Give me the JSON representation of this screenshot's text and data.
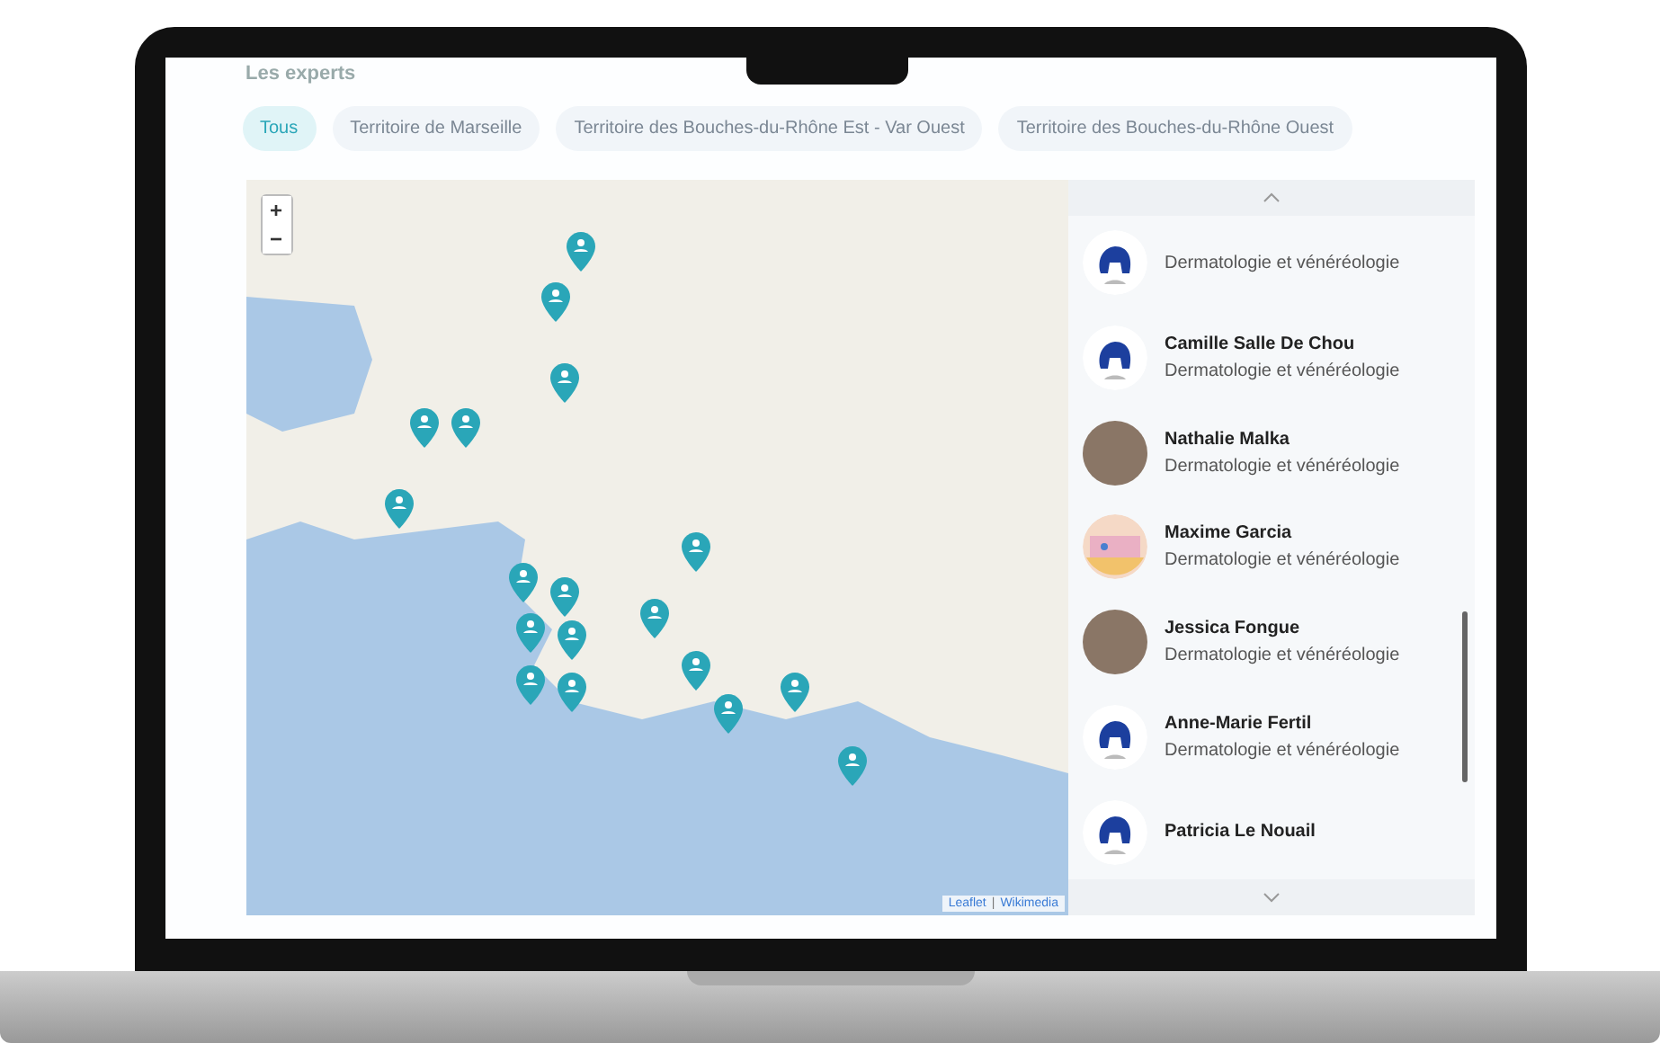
{
  "heading": "Les experts",
  "tabs": [
    {
      "label": "Tous",
      "selected": true
    },
    {
      "label": "Territoire de Marseille",
      "selected": false
    },
    {
      "label": "Territoire des Bouches-du-Rhône Est - Var Ouest",
      "selected": false
    },
    {
      "label": "Territoire des Bouches-du-Rhône Ouest",
      "selected": false
    }
  ],
  "map": {
    "zoom_in": "+",
    "zoom_out": "−",
    "attribution": [
      "Leaflet",
      "Wikimedia"
    ],
    "separator": "|"
  },
  "experts": [
    {
      "specialty": "Dermatologie et vénéréologie",
      "kind": "logo"
    },
    {
      "name": "Camille Salle De Chou",
      "specialty": "Dermatologie et vénéréologie",
      "kind": "logo"
    },
    {
      "name": "Nathalie Malka",
      "specialty": "Dermatologie et vénéréologie",
      "kind": "photo"
    },
    {
      "name": "Maxime Garcia",
      "specialty": "Dermatologie et vénéréologie",
      "kind": "illustration"
    },
    {
      "name": "Jessica Fongue",
      "specialty": "Dermatologie et vénéréologie",
      "kind": "photo"
    },
    {
      "name": "Anne-Marie Fertil",
      "specialty": "Dermatologie et vénéréologie",
      "kind": "logo"
    },
    {
      "name": "Patricia Le Nouail",
      "kind": "logo"
    }
  ]
}
